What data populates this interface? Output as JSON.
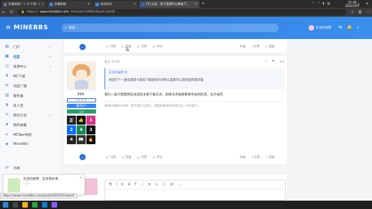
{
  "browser": {
    "tabs": [
      {
        "title": "辞墨鲸鲤 | “»  O 千鲜—始...",
        "active": false,
        "color": "#6b7280"
      },
      {
        "title": "辞墨鲸鲤",
        "active": false,
        "color": "#3b82f6"
      },
      {
        "title": "请选择符",
        "active": false,
        "color": "#3b82f6"
      },
      {
        "title": "[2] 公告 - 关于资源中心审核下...",
        "active": true,
        "color": "#2563eb"
      }
    ],
    "new_tab": "+",
    "url_prefix": "https://",
    "url_host": "www.minebbs.com",
    "url_path": "/threads/14885/#post-33435"
  },
  "header": {
    "logo": "MINEBBS",
    "search_placeholder": "搜索...",
    "username": "天治的雀野"
  },
  "sidebar": {
    "items": [
      {
        "label": "门户",
        "icon": "▤",
        "caret": "⌄",
        "active": false
      },
      {
        "label": "社区",
        "icon": "▦",
        "caret": "⌄",
        "active": true
      },
      {
        "label": "资源中心",
        "icon": "◫",
        "caret": "⌄",
        "active": false
      },
      {
        "label": "MC下载",
        "icon": "⬇",
        "caret": "",
        "active": false
      },
      {
        "label": "动态广播",
        "icon": "✉",
        "caret": "",
        "active": false
      },
      {
        "label": "服务器",
        "icon": "▥",
        "caret": "",
        "active": false
      },
      {
        "label": "名人堂",
        "icon": "♛",
        "caret": "",
        "active": false
      },
      {
        "label": "原创工坊",
        "icon": "✎",
        "caret": "⌄",
        "active": false
      },
      {
        "label": "我的收藏",
        "icon": "★",
        "caret": "",
        "active": false
      },
      {
        "label": "MCNav导航",
        "icon": "⌂",
        "caret": "",
        "active": false
      },
      {
        "label": "MineWiki",
        "icon": "◈",
        "caret": "",
        "active": false
      },
      {
        "label": "外网",
        "icon": "☍",
        "caret": "",
        "active": false
      }
    ]
  },
  "post1": {
    "actions": [
      "引用",
      "回复",
      "点赞",
      "评分"
    ],
    "right": [
      "举报",
      "+引用",
      "+ 回复"
    ]
  },
  "post2": {
    "time": "昨天 15:56",
    "num": "#3",
    "quote_author": "天治的雀野 说：",
    "quote_text": "请说打个一遍资源需小圆角下载链接的话要以晨曼可以直接里晦需添着",
    "text": "我们一般只需稿倒在此说的主要下载方式，如果点点角看那要考虑到的话，位于采药",
    "signature": "感谢阿最想对你做，那不是冬天抓住，请我想要收获在我们会一定的勇气。",
    "username": "YYT",
    "tag1": "【 1⭐ 】",
    "tag2": "精华达人",
    "tag3": "VIP",
    "badges": [
      "正",
      "👍",
      "1",
      "2",
      "4",
      "3",
      "4",
      "📖",
      "🔥"
    ],
    "actions": [
      "引用",
      "回复",
      "点赞",
      "评分"
    ],
    "right": [
      "举报",
      "+引用",
      "+ 回复"
    ]
  },
  "editor": {
    "tools": [
      "B",
      "I",
      "U",
      "A",
      "T",
      "◌",
      "≡",
      "∞",
      "▢",
      "☺",
      "…"
    ]
  },
  "notification": {
    "text1": "天治的雀野，全日快乐希",
    "text2": "- ◡̈ -"
  },
  "status_url": "https://www.minebbs.com/posts/93337/reward",
  "taskbar": {
    "time": "21:45",
    "date": "2022/11/7",
    "lang": "英"
  }
}
